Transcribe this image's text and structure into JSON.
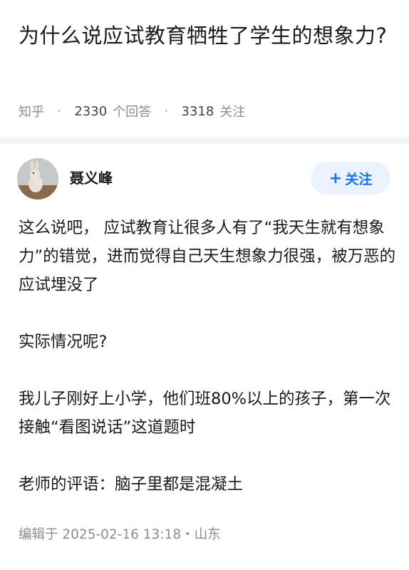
{
  "question": {
    "title": "为什么说应试教育牺牲了学生的想象力?",
    "source": "知乎",
    "answer_count": "2330",
    "answer_label": "个回答",
    "follow_count": "3318",
    "follow_label": "关注"
  },
  "answer": {
    "author_name": "聂义峰",
    "follow_button": "关注",
    "paragraphs": [
      "这么说吧， 应试教育让很多人有了“我天生就有想象力”的错觉，进而觉得自己天生想象力很强，被万恶的应试埋没了",
      "实际情况呢?",
      "我儿子刚好上小学，他们班80%以上的孩子，第一次接触“看图说话”这道题时",
      "老师的评语：脑子里都是混凝土"
    ],
    "edit_meta": "编辑于 2025-02-16 13:18・山东"
  },
  "colors": {
    "accent": "#1772f6",
    "follow_bg": "#ebf3ff",
    "meta_text": "#8c8c8c"
  }
}
